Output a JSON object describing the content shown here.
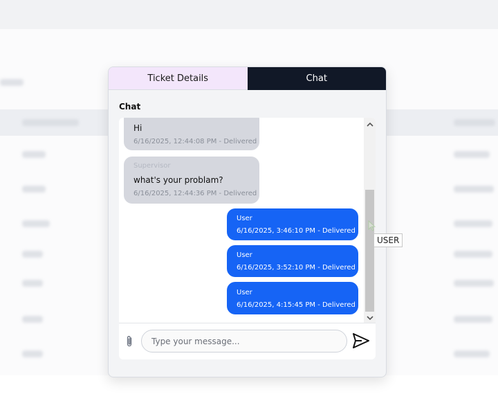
{
  "tabs": [
    {
      "label": "Ticket Details",
      "active": false
    },
    {
      "label": "Chat",
      "active": true
    }
  ],
  "chat": {
    "title": "Chat",
    "messages": [
      {
        "direction": "in",
        "sender": "",
        "text": "Hi",
        "meta": "6/16/2025, 12:44:08 PM - Delivered"
      },
      {
        "direction": "in",
        "sender": "Supervisor",
        "text": "what's your problam?",
        "meta": "6/16/2025, 12:44:36 PM - Delivered"
      },
      {
        "direction": "out",
        "sender": "User",
        "text": "",
        "meta": "6/16/2025, 3:46:10 PM - Delivered"
      },
      {
        "direction": "out",
        "sender": "User",
        "text": "",
        "meta": "6/16/2025, 3:52:10 PM - Delivered"
      },
      {
        "direction": "out",
        "sender": "User",
        "text": "",
        "meta": "6/16/2025, 4:15:45 PM - Delivered"
      }
    ],
    "input": {
      "placeholder": "Type your message...",
      "value": ""
    }
  },
  "tooltip": "USER",
  "icons": {
    "attach": "paperclip-icon",
    "send": "send-icon",
    "scroll_up": "chevron-up-icon",
    "scroll_down": "chevron-down-icon"
  },
  "colors": {
    "chat_tab_bg": "#111827",
    "details_tab_bg": "#f3e6fb",
    "outgoing_bubble": "#1664f5",
    "incoming_bubble": "#d5d7de"
  }
}
